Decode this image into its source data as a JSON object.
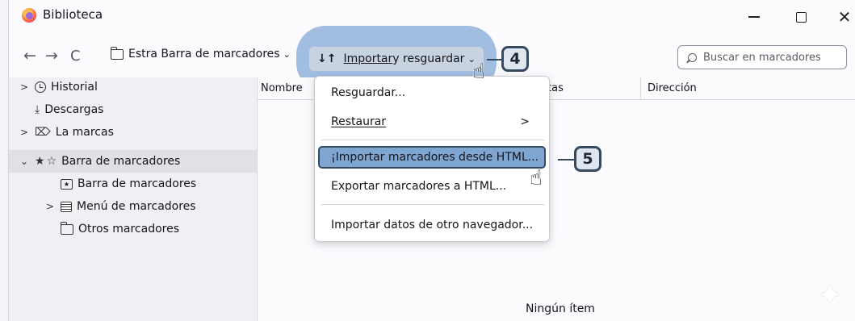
{
  "window": {
    "title": "Biblioteca",
    "min_glyph": "",
    "close_glyph": "✕"
  },
  "toolbar": {
    "back_glyph": "←",
    "forward_glyph": "→",
    "reload_glyph": "C",
    "folder_button_label": "Estra Barra de marcadores",
    "import_prefix": "Importar",
    "import_suffix": " y resguardar",
    "arrows_glyph": "↓↑",
    "search_placeholder": "Buscar en marcadores"
  },
  "callouts": {
    "step4": "4",
    "step5": "5"
  },
  "sidebar": {
    "items": [
      {
        "label": "Historial",
        "twisty": ">"
      },
      {
        "label": "Descargas",
        "twisty": ""
      },
      {
        "label": "La marcas",
        "twisty": ">"
      },
      {
        "label": "Barra de marcadores",
        "twisty": "⌄"
      },
      {
        "label": "Barra de marcadores",
        "twisty": ""
      },
      {
        "label": "Menú de marcadores",
        "twisty": ">"
      },
      {
        "label": "Otros marcadores",
        "twisty": ""
      }
    ]
  },
  "columns": {
    "name": "Nombre",
    "tags": "tas",
    "address": "Dirección"
  },
  "content": {
    "empty_text": "Ningún ítem"
  },
  "menu": {
    "items": [
      {
        "label": "Resguardar..."
      },
      {
        "label": "Restaurar",
        "submenu_glyph": ">"
      },
      {
        "label": "¡Importar marcadores desde HTML..."
      },
      {
        "label": "Exportar marcadores a HTML..."
      },
      {
        "label": "Importar datos de otro navegador..."
      }
    ]
  },
  "colors": {
    "highlight_blob": "#588cc8",
    "highlighted_item": "#7ea6d0",
    "callout_border": "#35495f"
  }
}
